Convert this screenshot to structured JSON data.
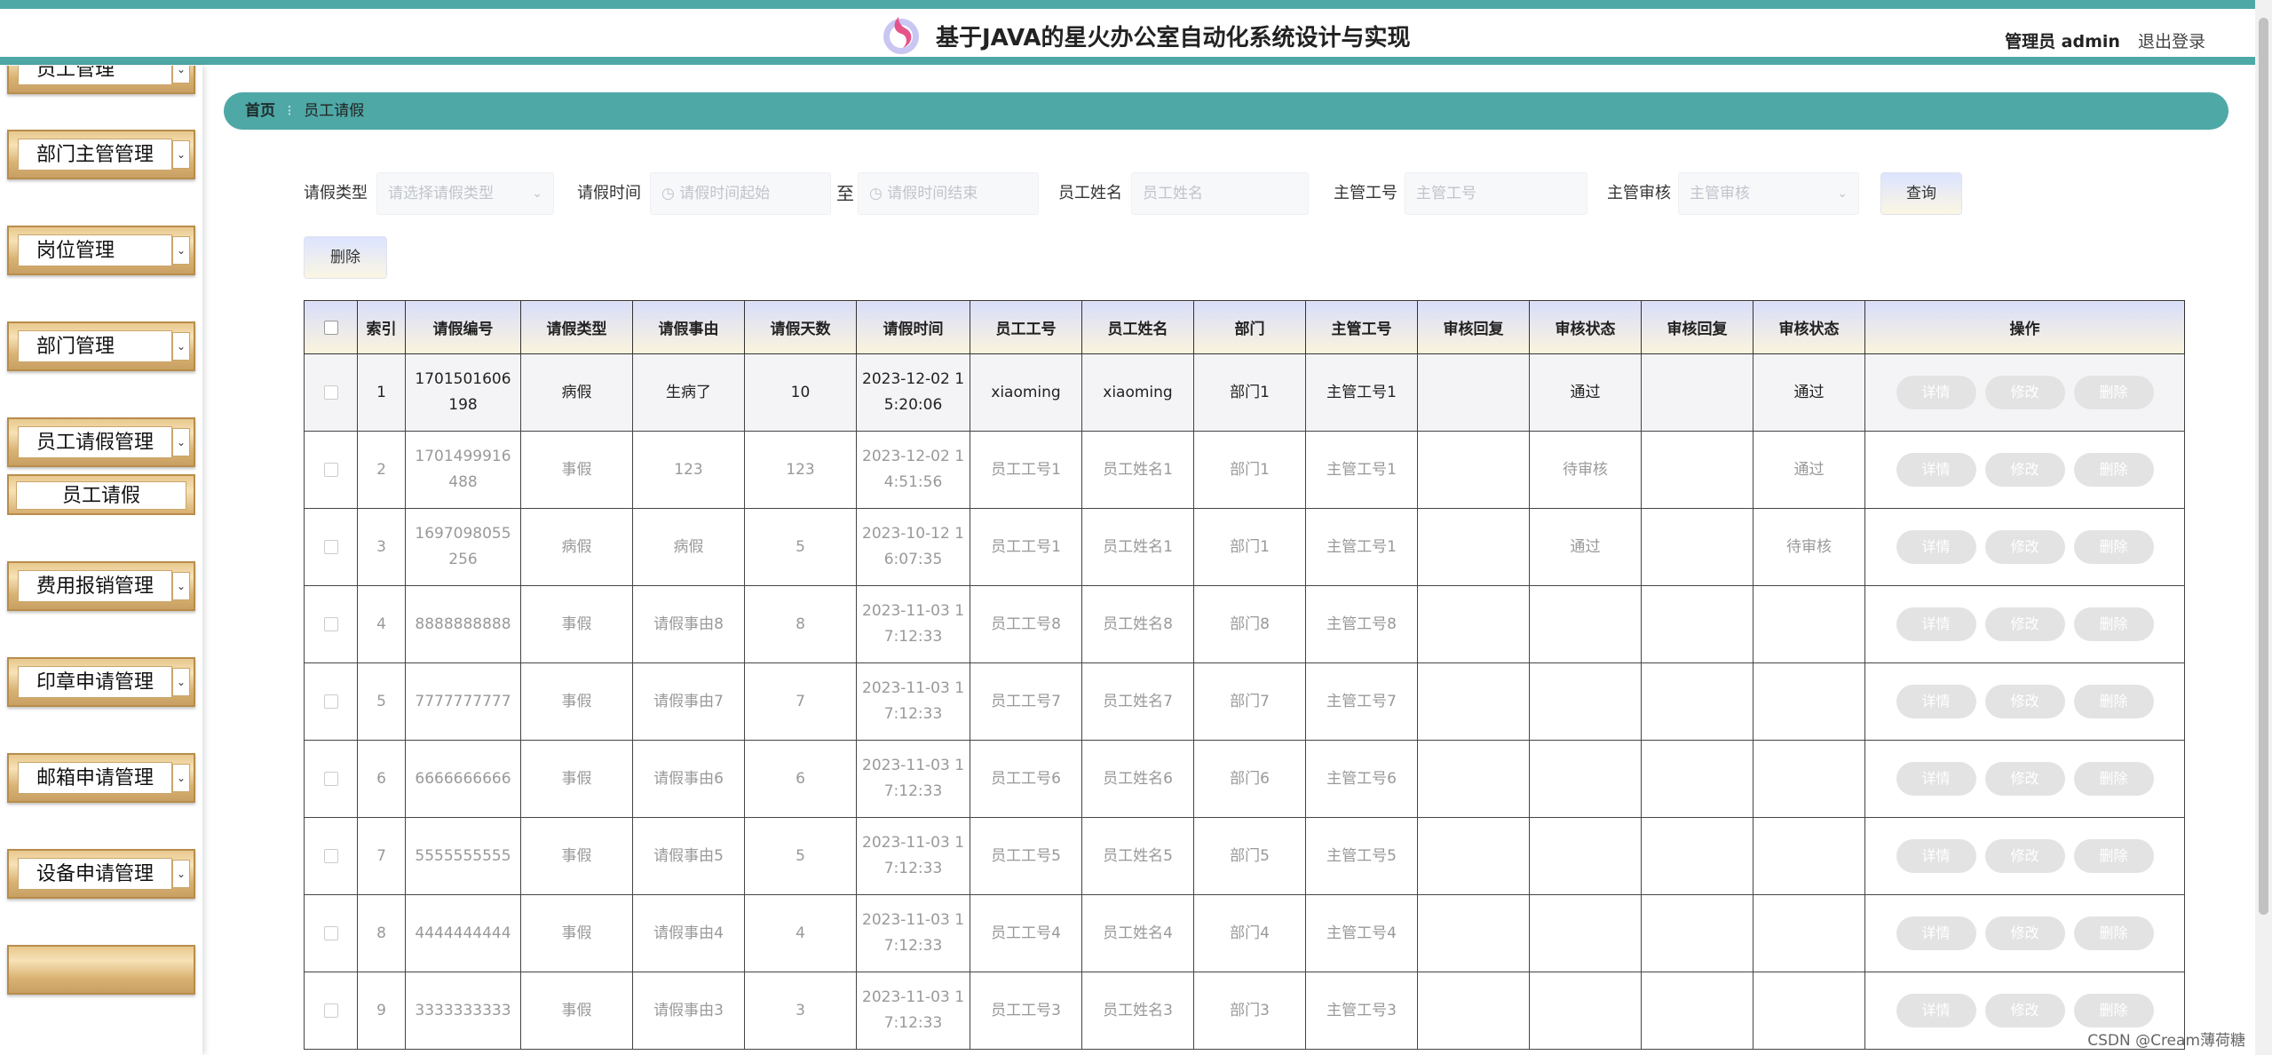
{
  "header": {
    "title": "基于JAVA的星火办公室自动化系统设计与实现",
    "user": "管理员 admin",
    "logout": "退出登录"
  },
  "sidebar": {
    "items": [
      {
        "label": "员工管理"
      },
      {
        "label": "部门主管管理"
      },
      {
        "label": "岗位管理"
      },
      {
        "label": "部门管理"
      },
      {
        "label": "员工请假管理"
      },
      {
        "label": "费用报销管理"
      },
      {
        "label": "印章申请管理"
      },
      {
        "label": "邮箱申请管理"
      },
      {
        "label": "设备申请管理"
      }
    ],
    "sub_item": "员工请假",
    "arrow_glyph": "⌄"
  },
  "breadcrumb": {
    "home": "首页",
    "separator": "⁝",
    "current": "员工请假"
  },
  "filters": {
    "leave_type_label": "请假类型",
    "leave_type_placeholder": "请选择请假类型",
    "leave_time_label": "请假时间",
    "time_start_placeholder": "请假时间起始",
    "to_label": "至",
    "time_end_placeholder": "请假时间结束",
    "emp_name_label": "员工姓名",
    "emp_name_placeholder": "员工姓名",
    "mgr_no_label": "主管工号",
    "mgr_no_placeholder": "主管工号",
    "mgr_review_label": "主管审核",
    "mgr_review_placeholder": "主管审核",
    "query": "查询",
    "delete": "删除"
  },
  "table": {
    "headers": [
      "索引",
      "请假编号",
      "请假类型",
      "请假事由",
      "请假天数",
      "请假时间",
      "员工工号",
      "员工姓名",
      "部门",
      "主管工号",
      "审核回复",
      "审核状态",
      "审核回复",
      "审核状态",
      "操作"
    ],
    "actions": [
      "详情",
      "修改",
      "删除"
    ],
    "rows": [
      {
        "idx": "1",
        "no": "1701501606198",
        "type": "病假",
        "reason": "生病了",
        "days": "10",
        "time": "2023-12-02 15:20:06",
        "emp_no": "xiaoming",
        "emp_name": "xiaoming",
        "dept": "部门1",
        "mgr_no": "主管工号1",
        "reply1": "",
        "status1": "通过",
        "reply2": "",
        "status2": "通过"
      },
      {
        "idx": "2",
        "no": "1701499916488",
        "type": "事假",
        "reason": "123",
        "days": "123",
        "time": "2023-12-02 14:51:56",
        "emp_no": "员工工号1",
        "emp_name": "员工姓名1",
        "dept": "部门1",
        "mgr_no": "主管工号1",
        "reply1": "",
        "status1": "待审核",
        "reply2": "",
        "status2": "通过"
      },
      {
        "idx": "3",
        "no": "1697098055256",
        "type": "病假",
        "reason": "病假",
        "days": "5",
        "time": "2023-10-12 16:07:35",
        "emp_no": "员工工号1",
        "emp_name": "员工姓名1",
        "dept": "部门1",
        "mgr_no": "主管工号1",
        "reply1": "",
        "status1": "通过",
        "reply2": "",
        "status2": "待审核"
      },
      {
        "idx": "4",
        "no": "8888888888",
        "type": "事假",
        "reason": "请假事由8",
        "days": "8",
        "time": "2023-11-03 17:12:33",
        "emp_no": "员工工号8",
        "emp_name": "员工姓名8",
        "dept": "部门8",
        "mgr_no": "主管工号8",
        "reply1": "",
        "status1": "",
        "reply2": "",
        "status2": ""
      },
      {
        "idx": "5",
        "no": "7777777777",
        "type": "事假",
        "reason": "请假事由7",
        "days": "7",
        "time": "2023-11-03 17:12:33",
        "emp_no": "员工工号7",
        "emp_name": "员工姓名7",
        "dept": "部门7",
        "mgr_no": "主管工号7",
        "reply1": "",
        "status1": "",
        "reply2": "",
        "status2": ""
      },
      {
        "idx": "6",
        "no": "6666666666",
        "type": "事假",
        "reason": "请假事由6",
        "days": "6",
        "time": "2023-11-03 17:12:33",
        "emp_no": "员工工号6",
        "emp_name": "员工姓名6",
        "dept": "部门6",
        "mgr_no": "主管工号6",
        "reply1": "",
        "status1": "",
        "reply2": "",
        "status2": ""
      },
      {
        "idx": "7",
        "no": "5555555555",
        "type": "事假",
        "reason": "请假事由5",
        "days": "5",
        "time": "2023-11-03 17:12:33",
        "emp_no": "员工工号5",
        "emp_name": "员工姓名5",
        "dept": "部门5",
        "mgr_no": "主管工号5",
        "reply1": "",
        "status1": "",
        "reply2": "",
        "status2": ""
      },
      {
        "idx": "8",
        "no": "4444444444",
        "type": "事假",
        "reason": "请假事由4",
        "days": "4",
        "time": "2023-11-03 17:12:33",
        "emp_no": "员工工号4",
        "emp_name": "员工姓名4",
        "dept": "部门4",
        "mgr_no": "主管工号4",
        "reply1": "",
        "status1": "",
        "reply2": "",
        "status2": ""
      },
      {
        "idx": "9",
        "no": "3333333333",
        "type": "事假",
        "reason": "请假事由3",
        "days": "3",
        "time": "2023-11-03 17:12:33",
        "emp_no": "员工工号3",
        "emp_name": "员工姓名3",
        "dept": "部门3",
        "mgr_no": "主管工号3",
        "reply1": "",
        "status1": "",
        "reply2": "",
        "status2": ""
      }
    ]
  },
  "watermark": "CSDN @Cream薄荷糖",
  "colors": {
    "accent": "#4ea8a6",
    "menu_gold": "#d8b070"
  }
}
